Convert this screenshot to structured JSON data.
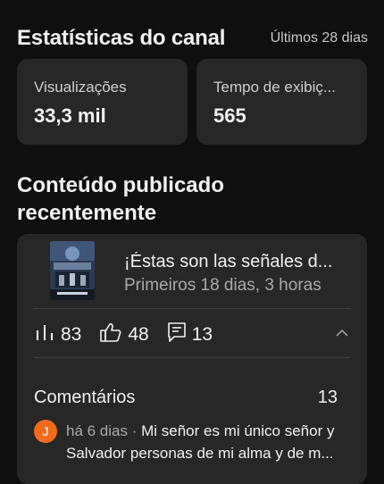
{
  "header": {
    "title": "Estatísticas do canal",
    "range": "Últimos 28 dias"
  },
  "stats": [
    {
      "label": "Visualizações",
      "value": "33,3 mil"
    },
    {
      "label": "Tempo de exibiç...",
      "value": "565"
    }
  ],
  "section": {
    "title": "Conteúdo publicado recentemente"
  },
  "video": {
    "title": "¡Éstas son las señales d...",
    "subtitle": "Primeiros 18 dias, 3 horas",
    "views": "83",
    "likes": "48",
    "comments": "13"
  },
  "comments": {
    "label": "Comentários",
    "count": "13",
    "first": {
      "avatar_letter": "J",
      "meta": "há 6 dias · ",
      "text": "Mi señor es mi único señor y Salvador personas de mi alma y de m..."
    }
  },
  "colors": {
    "background": "#0f0f0f",
    "card": "#272727",
    "avatar": "#f26b1d"
  },
  "icons": [
    "views-bars-icon",
    "thumbs-up-icon",
    "comment-icon",
    "chevron-up-icon"
  ]
}
